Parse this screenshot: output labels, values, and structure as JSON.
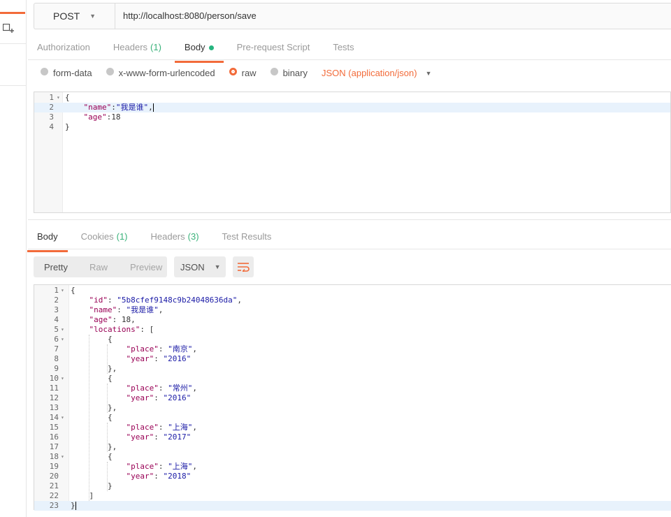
{
  "request": {
    "method": "POST",
    "url": "http://localhost:8080/person/save",
    "tabs": [
      {
        "label": "Authorization",
        "count": ""
      },
      {
        "label": "Headers",
        "count": "(1)"
      },
      {
        "label": "Body",
        "count": ""
      },
      {
        "label": "Pre-request Script",
        "count": ""
      },
      {
        "label": "Tests",
        "count": ""
      }
    ],
    "body_modes": [
      "form-data",
      "x-www-form-urlencoded",
      "raw",
      "binary"
    ],
    "selected_mode": "raw",
    "content_type": "JSON (application/json)",
    "body_lines": [
      {
        "num": "1",
        "fold": "▾",
        "parts": [
          [
            "p",
            "{"
          ]
        ]
      },
      {
        "num": "2",
        "fold": "",
        "parts": [
          [
            "k",
            "    \"name\""
          ],
          [
            "p",
            ":"
          ],
          [
            "s",
            "\"我是谁\""
          ],
          [
            "p",
            ","
          ]
        ],
        "highlight": true,
        "cursor": true
      },
      {
        "num": "3",
        "fold": "",
        "parts": [
          [
            "k",
            "    \"age\""
          ],
          [
            "p",
            ":"
          ],
          [
            "n",
            "18"
          ]
        ]
      },
      {
        "num": "4",
        "fold": "",
        "parts": [
          [
            "p",
            "}"
          ]
        ]
      }
    ]
  },
  "response": {
    "tabs": [
      {
        "label": "Body",
        "count": ""
      },
      {
        "label": "Cookies",
        "count": "(1)"
      },
      {
        "label": "Headers",
        "count": "(3)"
      },
      {
        "label": "Test Results",
        "count": ""
      }
    ],
    "views": [
      "Pretty",
      "Raw",
      "Preview"
    ],
    "active_view": "Pretty",
    "format": "JSON",
    "lines": [
      {
        "num": "1",
        "fold": "▾",
        "parts": [
          [
            "p",
            "{"
          ]
        ]
      },
      {
        "num": "2",
        "fold": "",
        "parts": [
          [
            "k",
            "    \"id\""
          ],
          [
            "p",
            ": "
          ],
          [
            "s",
            "\"5b8cfef9148c9b24048636da\""
          ],
          [
            "p",
            ","
          ]
        ]
      },
      {
        "num": "3",
        "fold": "",
        "parts": [
          [
            "k",
            "    \"name\""
          ],
          [
            "p",
            ": "
          ],
          [
            "s",
            "\"我是谁\""
          ],
          [
            "p",
            ","
          ]
        ]
      },
      {
        "num": "4",
        "fold": "",
        "parts": [
          [
            "k",
            "    \"age\""
          ],
          [
            "p",
            ": "
          ],
          [
            "n",
            "18"
          ],
          [
            "p",
            ","
          ]
        ]
      },
      {
        "num": "5",
        "fold": "▾",
        "parts": [
          [
            "k",
            "    \"locations\""
          ],
          [
            "p",
            ": ["
          ]
        ]
      },
      {
        "num": "6",
        "fold": "▾",
        "parts": [
          [
            "p",
            "        {"
          ]
        ]
      },
      {
        "num": "7",
        "fold": "",
        "parts": [
          [
            "k",
            "            \"place\""
          ],
          [
            "p",
            ": "
          ],
          [
            "s",
            "\"南京\""
          ],
          [
            "p",
            ","
          ]
        ]
      },
      {
        "num": "8",
        "fold": "",
        "parts": [
          [
            "k",
            "            \"year\""
          ],
          [
            "p",
            ": "
          ],
          [
            "s",
            "\"2016\""
          ]
        ]
      },
      {
        "num": "9",
        "fold": "",
        "parts": [
          [
            "p",
            "        },"
          ]
        ]
      },
      {
        "num": "10",
        "fold": "▾",
        "parts": [
          [
            "p",
            "        {"
          ]
        ]
      },
      {
        "num": "11",
        "fold": "",
        "parts": [
          [
            "k",
            "            \"place\""
          ],
          [
            "p",
            ": "
          ],
          [
            "s",
            "\"常州\""
          ],
          [
            "p",
            ","
          ]
        ]
      },
      {
        "num": "12",
        "fold": "",
        "parts": [
          [
            "k",
            "            \"year\""
          ],
          [
            "p",
            ": "
          ],
          [
            "s",
            "\"2016\""
          ]
        ]
      },
      {
        "num": "13",
        "fold": "",
        "parts": [
          [
            "p",
            "        },"
          ]
        ]
      },
      {
        "num": "14",
        "fold": "▾",
        "parts": [
          [
            "p",
            "        {"
          ]
        ]
      },
      {
        "num": "15",
        "fold": "",
        "parts": [
          [
            "k",
            "            \"place\""
          ],
          [
            "p",
            ": "
          ],
          [
            "s",
            "\"上海\""
          ],
          [
            "p",
            ","
          ]
        ]
      },
      {
        "num": "16",
        "fold": "",
        "parts": [
          [
            "k",
            "            \"year\""
          ],
          [
            "p",
            ": "
          ],
          [
            "s",
            "\"2017\""
          ]
        ]
      },
      {
        "num": "17",
        "fold": "",
        "parts": [
          [
            "p",
            "        },"
          ]
        ]
      },
      {
        "num": "18",
        "fold": "▾",
        "parts": [
          [
            "p",
            "        {"
          ]
        ]
      },
      {
        "num": "19",
        "fold": "",
        "parts": [
          [
            "k",
            "            \"place\""
          ],
          [
            "p",
            ": "
          ],
          [
            "s",
            "\"上海\""
          ],
          [
            "p",
            ","
          ]
        ]
      },
      {
        "num": "20",
        "fold": "",
        "parts": [
          [
            "k",
            "            \"year\""
          ],
          [
            "p",
            ": "
          ],
          [
            "s",
            "\"2018\""
          ]
        ]
      },
      {
        "num": "21",
        "fold": "",
        "parts": [
          [
            "p",
            "        }"
          ]
        ]
      },
      {
        "num": "22",
        "fold": "",
        "parts": [
          [
            "p",
            "    ]"
          ]
        ]
      },
      {
        "num": "23",
        "fold": "",
        "parts": [
          [
            "p",
            "}"
          ]
        ],
        "highlight": true,
        "cursor": true
      }
    ]
  },
  "colors": {
    "accent": "#f26b3a",
    "count_green": "#3ab27a",
    "dot_green": "#26b47f"
  },
  "icons": {
    "new_tab": "new-tab-icon",
    "wrap": "wrap-lines-icon"
  }
}
